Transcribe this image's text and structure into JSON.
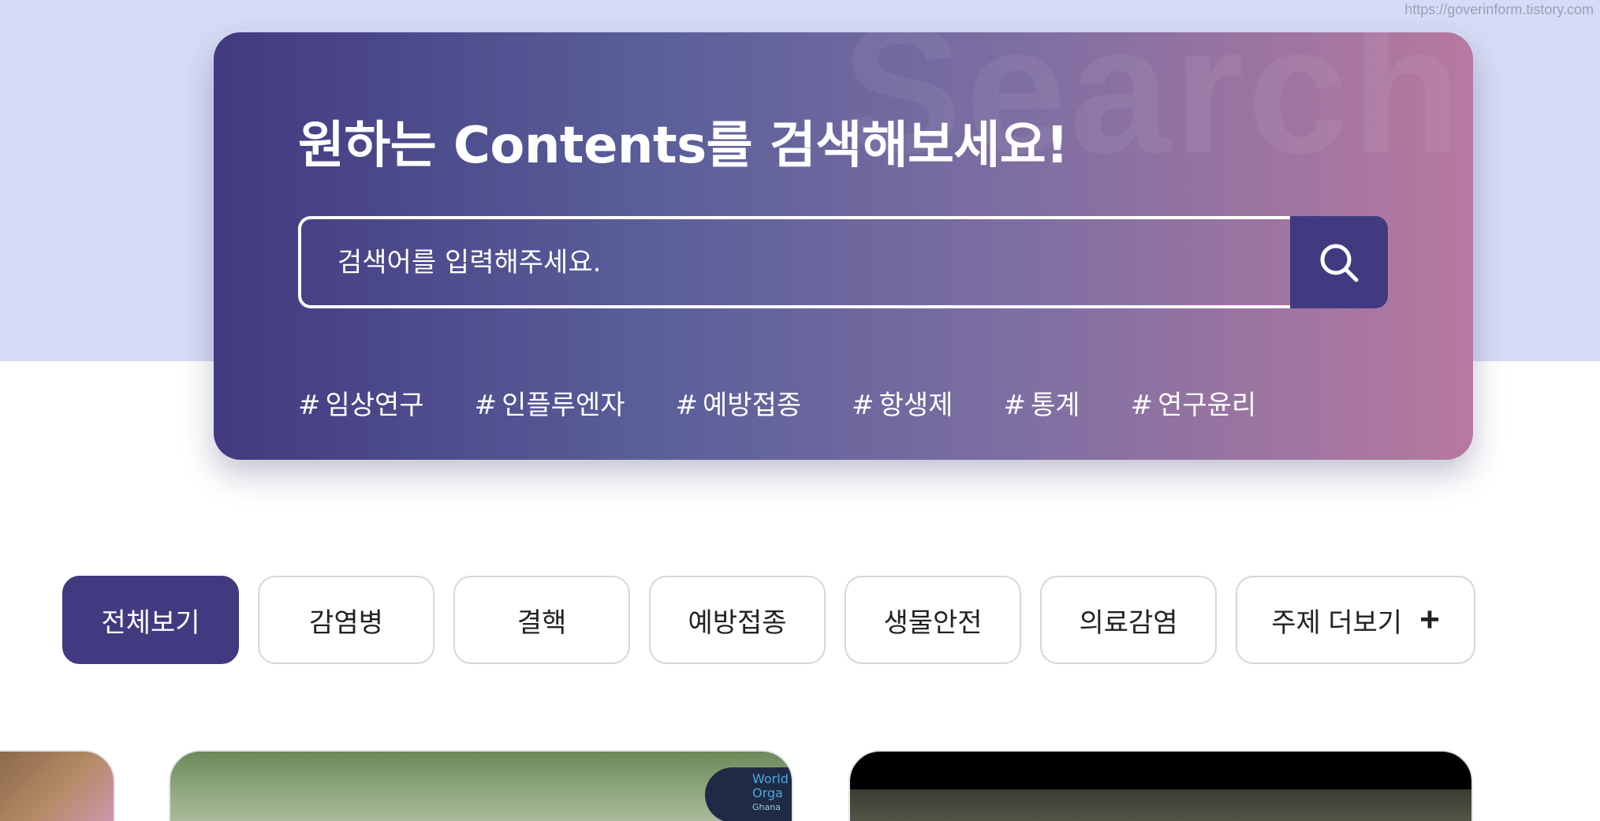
{
  "watermark": {
    "url": "https://goverinform.tistory.com"
  },
  "hero": {
    "background_word": "Search",
    "title": "원하는 Contents를 검색해보세요!",
    "search": {
      "placeholder": "검색어를 입력해주세요.",
      "button_icon": "search-icon"
    },
    "tags": [
      {
        "hash": "#",
        "label": "임상연구"
      },
      {
        "hash": "#",
        "label": "인플루엔자"
      },
      {
        "hash": "#",
        "label": "예방접종"
      },
      {
        "hash": "#",
        "label": "항생제"
      },
      {
        "hash": "#",
        "label": "통계"
      },
      {
        "hash": "#",
        "label": "연구윤리"
      }
    ]
  },
  "categories": {
    "items": [
      {
        "label": "전체보기",
        "active": true
      },
      {
        "label": "감염병"
      },
      {
        "label": "결핵"
      },
      {
        "label": "예방접종"
      },
      {
        "label": "생물안전"
      },
      {
        "label": "의료감염"
      }
    ],
    "more": {
      "label": "주제 더보기",
      "icon": "plus-icon"
    }
  },
  "cards": {
    "mid_badge_lines": [
      "World",
      "Orga",
      "Ghana"
    ]
  },
  "colors": {
    "primary": "#423a80",
    "band": "#d6dcf5",
    "gradient_start": "#423a80",
    "gradient_end": "#b779a0"
  }
}
